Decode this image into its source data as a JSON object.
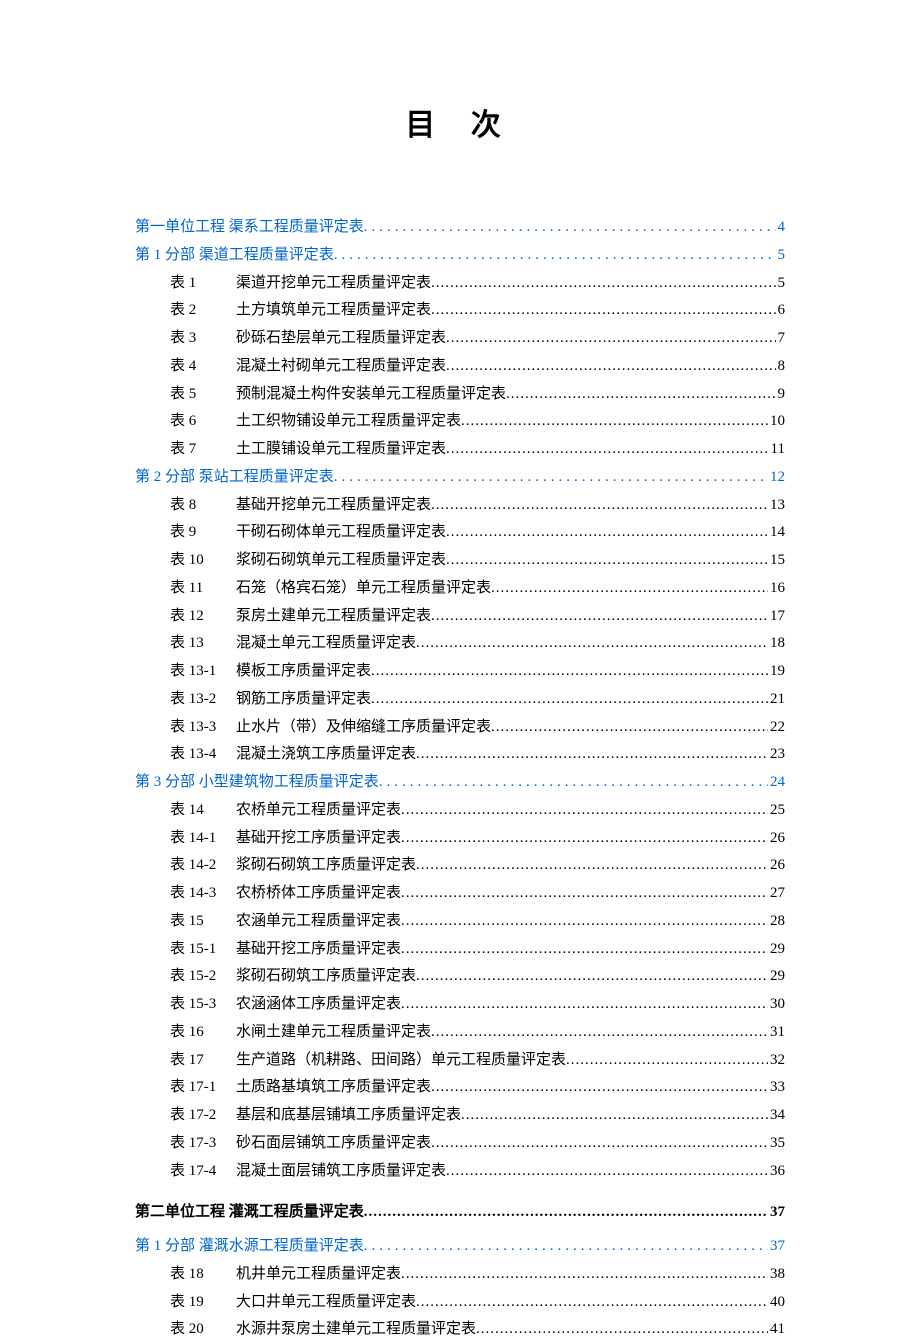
{
  "title": "目  次",
  "entries": [
    {
      "type": "section-link",
      "label": "第一单位工程  渠系工程质量评定表",
      "page": "4"
    },
    {
      "type": "section-link",
      "label": "第 1 分部  渠道工程质量评定表",
      "page": "5"
    },
    {
      "type": "table",
      "num": "表 1",
      "title": "渠道开挖单元工程质量评定表",
      "page": "5"
    },
    {
      "type": "table",
      "num": "表 2",
      "title": "土方填筑单元工程质量评定表",
      "page": "6"
    },
    {
      "type": "table",
      "num": "表 3",
      "title": "砂砾石垫层单元工程质量评定表",
      "page": "7"
    },
    {
      "type": "table",
      "num": "表 4",
      "title": "混凝土衬砌单元工程质量评定表",
      "page": "8"
    },
    {
      "type": "table",
      "num": "表 5",
      "title": "预制混凝土构件安装单元工程质量评定表",
      "page": "9"
    },
    {
      "type": "table",
      "num": "表 6",
      "title": "土工织物铺设单元工程质量评定表",
      "page": "10"
    },
    {
      "type": "table",
      "num": "表 7",
      "title": "土工膜铺设单元工程质量评定表",
      "page": "11"
    },
    {
      "type": "section-link",
      "label": "第 2 分部  泵站工程质量评定表",
      "page": "12"
    },
    {
      "type": "table",
      "num": "表 8",
      "title": "基础开挖单元工程质量评定表",
      "page": "13"
    },
    {
      "type": "table",
      "num": "表 9",
      "title": "干砌石砌体单元工程质量评定表",
      "page": "14"
    },
    {
      "type": "table",
      "num": "表 10",
      "title": "浆砌石砌筑单元工程质量评定表",
      "page": "15"
    },
    {
      "type": "table",
      "num": "表 11",
      "title": "石笼（格宾石笼）单元工程质量评定表",
      "page": "16"
    },
    {
      "type": "table",
      "num": "表 12",
      "title": "泵房土建单元工程质量评定表",
      "page": "17"
    },
    {
      "type": "table",
      "num": "表 13",
      "title": "混凝土单元工程质量评定表",
      "page": "18"
    },
    {
      "type": "table",
      "num": "表 13-1",
      "title": "模板工序质量评定表",
      "page": "19"
    },
    {
      "type": "table",
      "num": "表 13-2",
      "title": "钢筋工序质量评定表",
      "page": "21"
    },
    {
      "type": "table",
      "num": "表 13-3",
      "title": "止水片（带）及伸缩缝工序质量评定表",
      "page": "22"
    },
    {
      "type": "table",
      "num": "表 13-4",
      "title": "混凝土浇筑工序质量评定表",
      "page": "23"
    },
    {
      "type": "section-link",
      "label": "第 3 分部  小型建筑物工程质量评定表",
      "page": "24"
    },
    {
      "type": "table",
      "num": "表 14",
      "title": "农桥单元工程质量评定表",
      "page": "25"
    },
    {
      "type": "table",
      "num": "表 14-1",
      "title": "基础开挖工序质量评定表",
      "page": "26"
    },
    {
      "type": "table",
      "num": "表 14-2",
      "title": "浆砌石砌筑工序质量评定表",
      "page": "26"
    },
    {
      "type": "table",
      "num": "表 14-3",
      "title": "农桥桥体工序质量评定表",
      "page": "27"
    },
    {
      "type": "table",
      "num": "表 15",
      "title": "农涵单元工程质量评定表",
      "page": "28"
    },
    {
      "type": "table",
      "num": "表 15-1",
      "title": "基础开挖工序质量评定表",
      "page": "29"
    },
    {
      "type": "table",
      "num": "表 15-2",
      "title": "浆砌石砌筑工序质量评定表",
      "page": "29"
    },
    {
      "type": "table",
      "num": "表 15-3",
      "title": "农涵涵体工序质量评定表",
      "page": "30"
    },
    {
      "type": "table",
      "num": "表 16",
      "title": "水闸土建单元工程质量评定表",
      "page": "31"
    },
    {
      "type": "table",
      "num": "表 17",
      "title": "生产道路（机耕路、田间路）单元工程质量评定表",
      "page": "32"
    },
    {
      "type": "table",
      "num": "表 17-1",
      "title": "土质路基填筑工序质量评定表",
      "page": "33"
    },
    {
      "type": "table",
      "num": "表 17-2",
      "title": "基层和底基层铺填工序质量评定表",
      "page": "34"
    },
    {
      "type": "table",
      "num": "表 17-3",
      "title": "砂石面层铺筑工序质量评定表",
      "page": "35"
    },
    {
      "type": "table",
      "num": "表 17-4",
      "title": "混凝土面层铺筑工序质量评定表",
      "page": "36"
    },
    {
      "type": "section-bold",
      "label": "第二单位工程   灌溉工程质量评定表",
      "page": "37"
    },
    {
      "type": "section-link",
      "label": "第 1 分部  灌溉水源工程质量评定表",
      "page": "37"
    },
    {
      "type": "table",
      "num": "表 18",
      "title": "机井单元工程质量评定表",
      "page": "38"
    },
    {
      "type": "table",
      "num": "表 19",
      "title": "大口井单元工程质量评定表",
      "page": "40"
    },
    {
      "type": "table",
      "num": "表 20",
      "title": "水源井泵房土建单元工程质量评定表",
      "page": "41"
    }
  ]
}
